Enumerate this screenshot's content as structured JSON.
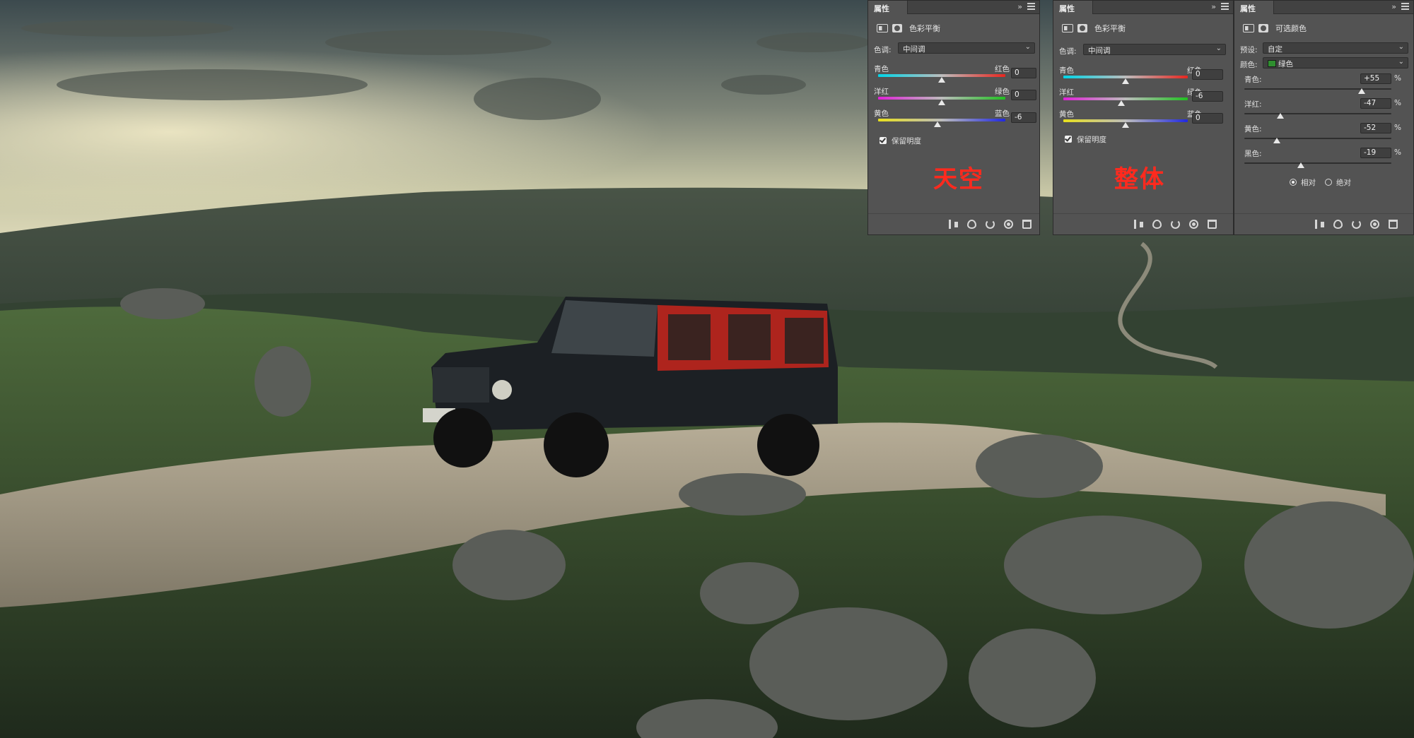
{
  "panels": [
    {
      "tab": "属性",
      "adjustment": "色彩平衡",
      "tone_label": "色调:",
      "tone_value": "中间调",
      "sliders": [
        {
          "left": "青色",
          "right": "红色",
          "value": "0"
        },
        {
          "left": "洋红",
          "right": "绿色",
          "value": "0"
        },
        {
          "left": "黄色",
          "right": "蓝色",
          "value": "-6"
        }
      ],
      "preserve_luminosity": "保留明度",
      "annotation": "天空"
    },
    {
      "tab": "属性",
      "adjustment": "色彩平衡",
      "tone_label": "色调:",
      "tone_value": "中间调",
      "sliders": [
        {
          "left": "青色",
          "right": "红色",
          "value": "0"
        },
        {
          "left": "洋红",
          "right": "绿色",
          "value": "-6"
        },
        {
          "left": "黄色",
          "right": "蓝色",
          "value": "0"
        }
      ],
      "preserve_luminosity": "保留明度",
      "annotation": "整体"
    },
    {
      "tab": "属性",
      "adjustment": "可选颜色",
      "preset_label": "预设:",
      "preset_value": "自定",
      "colors_label": "颜色:",
      "colors_value": "绿色",
      "sliders": [
        {
          "label": "青色:",
          "value": "+55",
          "unit": "%"
        },
        {
          "label": "洋红:",
          "value": "-47",
          "unit": "%"
        },
        {
          "label": "黄色:",
          "value": "-52",
          "unit": "%"
        },
        {
          "label": "黑色:",
          "value": "-19",
          "unit": "%"
        }
      ],
      "method_relative": "相对",
      "method_absolute": "绝对"
    }
  ],
  "colors": {
    "annotation": "#ff2a1e",
    "panel_bg": "#535353",
    "car_door_highlight": "#c8261c",
    "green_swatch": "#2f8f2f"
  }
}
